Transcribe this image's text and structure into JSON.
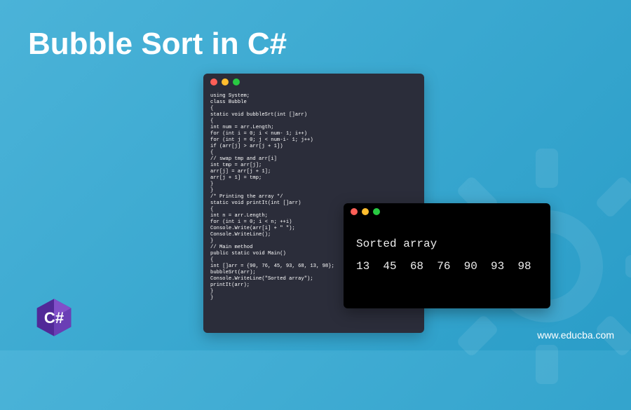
{
  "title": "Bubble Sort in C#",
  "code_window": {
    "code": "using System;\nclass Bubble\n{\nstatic void bubbleSrt(int []arr)\n{\nint num = arr.Length;\nfor (int i = 0; i < num- 1; i++)\nfor (int j = 0; j < num-i- 1; j++)\nif (arr[j] > arr[j + 1])\n{\n// swap tmp and arr[i]\nint tmp = arr[j];\narr[j] = arr[j + 1];\narr[j + 1] = tmp;\n}\n}\n/* Printing the array */\nstatic void printIt(int []arr)\n{\nint n = arr.Length;\nfor (int i = 0; i < n; ++i)\nConsole.Write(arr[i] + \" \");\nConsole.WriteLine();\n}\n// Main method\npublic static void Main()\n{\nint []arr = {90, 76, 45, 93, 68, 13, 98};\nbubbleSrt(arr);\nConsole.WriteLine(\"Sorted array\");\nprintIt(arr);\n}\n}"
  },
  "output_window": {
    "text": "Sorted array\n13  45  68  76  90  93  98"
  },
  "footer": {
    "url": "www.educba.com"
  },
  "logo": {
    "name": "csharp-logo",
    "color_outer": "#6b4ba0",
    "color_inner": "#9b6dd7",
    "text": "C#"
  },
  "traffic_lights": {
    "red": "#ff5f57",
    "yellow": "#ffbd2e",
    "green": "#28ca42"
  }
}
